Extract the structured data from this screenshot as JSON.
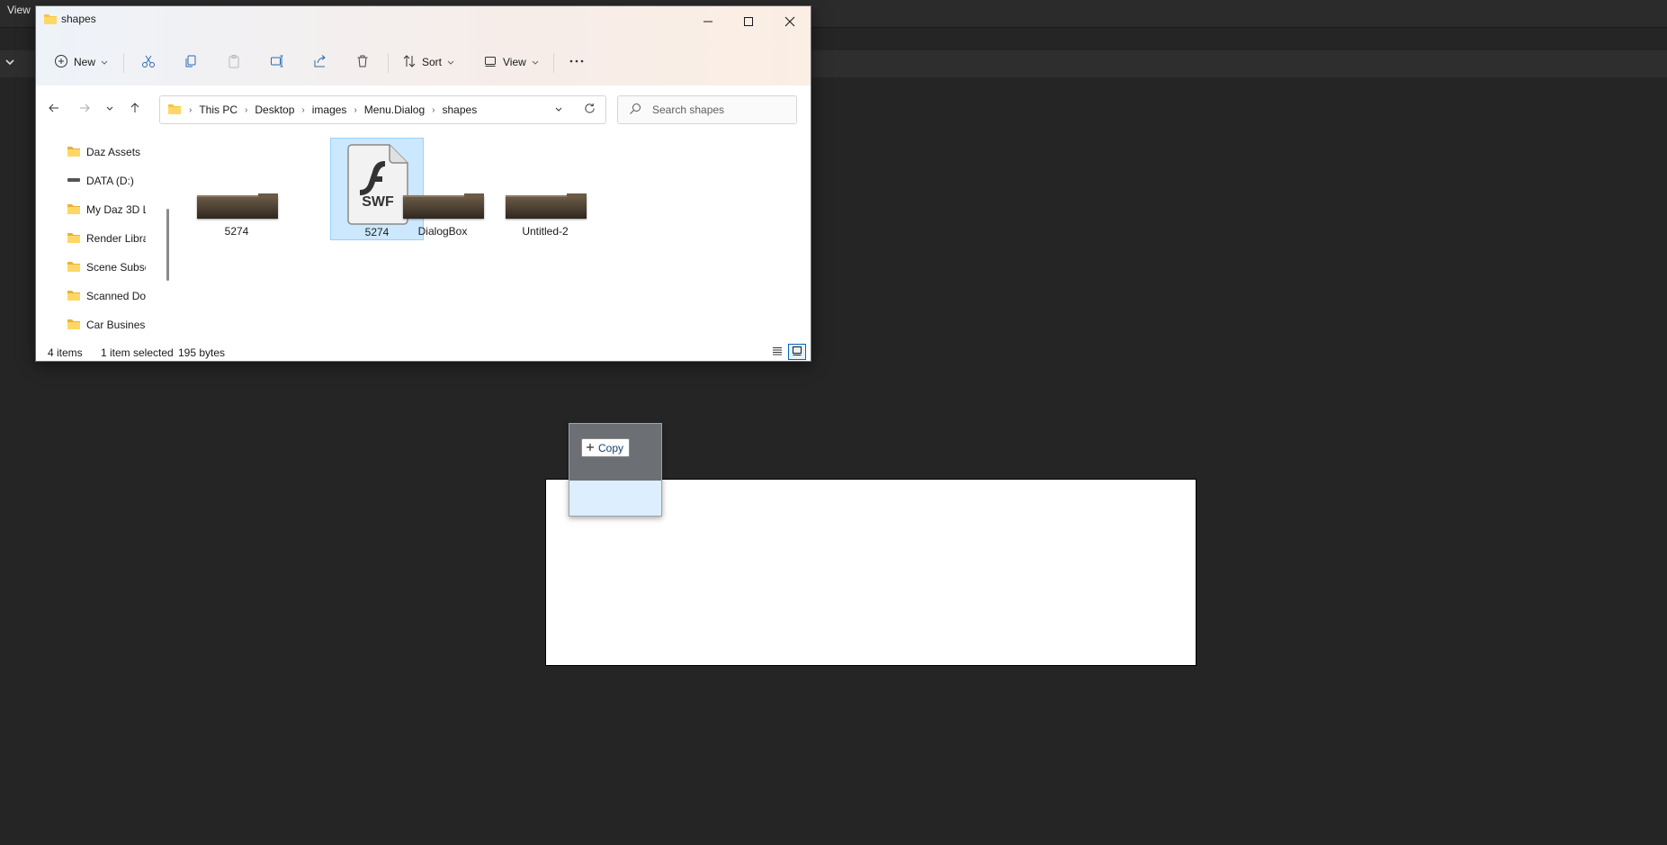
{
  "background_app": {
    "menu": {
      "view_label": "View"
    }
  },
  "drag": {
    "badge_label": "Copy"
  },
  "explorer": {
    "title": "shapes",
    "window_controls": {
      "minimize": "minimize-icon",
      "maximize": "maximize-icon",
      "close": "close-icon"
    },
    "command_bar": {
      "new_label": "New",
      "sort_label": "Sort",
      "view_label": "View",
      "icons": [
        "cut-icon",
        "copy-icon",
        "paste-icon",
        "rename-icon",
        "share-icon",
        "delete-icon",
        "more-icon"
      ]
    },
    "address": {
      "crumbs": [
        "This PC",
        "Desktop",
        "images",
        "Menu.Dialog",
        "shapes"
      ]
    },
    "search": {
      "placeholder": "Search shapes"
    },
    "nav_pane": [
      {
        "label": "Daz Assets",
        "icon": "folder-icon"
      },
      {
        "label": "DATA (D:)",
        "icon": "drive-icon"
      },
      {
        "label": "My Daz 3D L",
        "icon": "folder-icon"
      },
      {
        "label": "Render Libra",
        "icon": "folder-icon"
      },
      {
        "label": "Scene Subse",
        "icon": "folder-icon"
      },
      {
        "label": "Scanned Do",
        "icon": "folder-icon"
      },
      {
        "label": "Car Busines",
        "icon": "folder-icon"
      }
    ],
    "files": [
      {
        "name": "5274",
        "type": "folder-thumbnail",
        "selected": false
      },
      {
        "name": "5274",
        "type": "swf",
        "badge": "SWF",
        "selected": true
      },
      {
        "name": "DialogBox",
        "type": "folder-thumbnail",
        "selected": false
      },
      {
        "name": "Untitled-2",
        "type": "folder-thumbnail",
        "selected": false
      }
    ],
    "status": {
      "item_count": "4 items",
      "selection": "1 item selected",
      "size": "195 bytes"
    },
    "colors": {
      "selection": "#cce8ff",
      "selection_border": "#99d1ff",
      "folder": "#f4c542",
      "accent": "#0067c0"
    }
  }
}
